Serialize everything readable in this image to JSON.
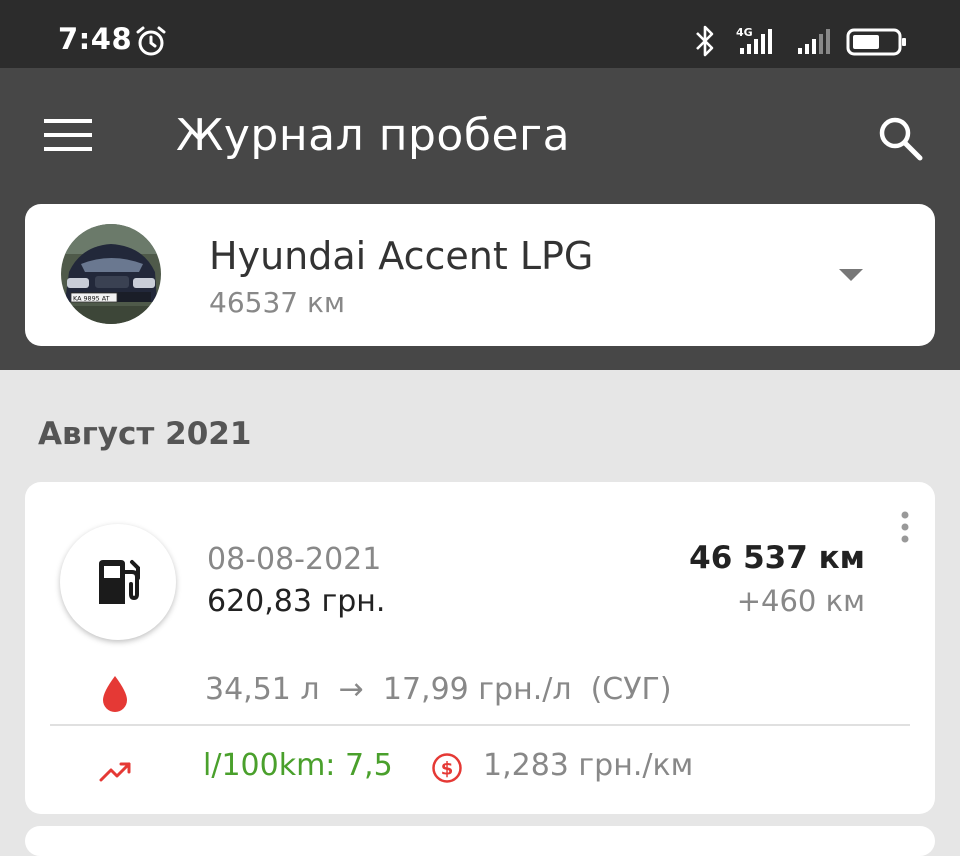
{
  "status_bar": {
    "time": "7:48",
    "network_label": "4G",
    "icons": [
      "alarm-icon",
      "bluetooth-icon",
      "signal-4g-icon",
      "signal-icon",
      "battery-icon"
    ]
  },
  "app_bar": {
    "title": "Журнал пробега",
    "icons": [
      "menu-icon",
      "search-icon"
    ]
  },
  "vehicle": {
    "name": "Hyundai Accent LPG",
    "odometer": "46537 км",
    "plate": "KA 9895 AT"
  },
  "section": {
    "month": "Август 2021"
  },
  "entry": {
    "date": "08-08-2021",
    "cost": "620,83 грн.",
    "odometer": "46 537 км",
    "distance": "+460 км",
    "volume_line": "34,51 л  →  17,99 грн./л  (СУГ)",
    "consumption": "l/100km: 7,5",
    "cost_per_km": "1,283 грн./км"
  },
  "colors": {
    "status_bar": "#2c2c2c",
    "app_bar": "#474747",
    "background": "#e6e6e6",
    "consumption_green": "#4aa02c",
    "accent_red": "#e53935"
  }
}
